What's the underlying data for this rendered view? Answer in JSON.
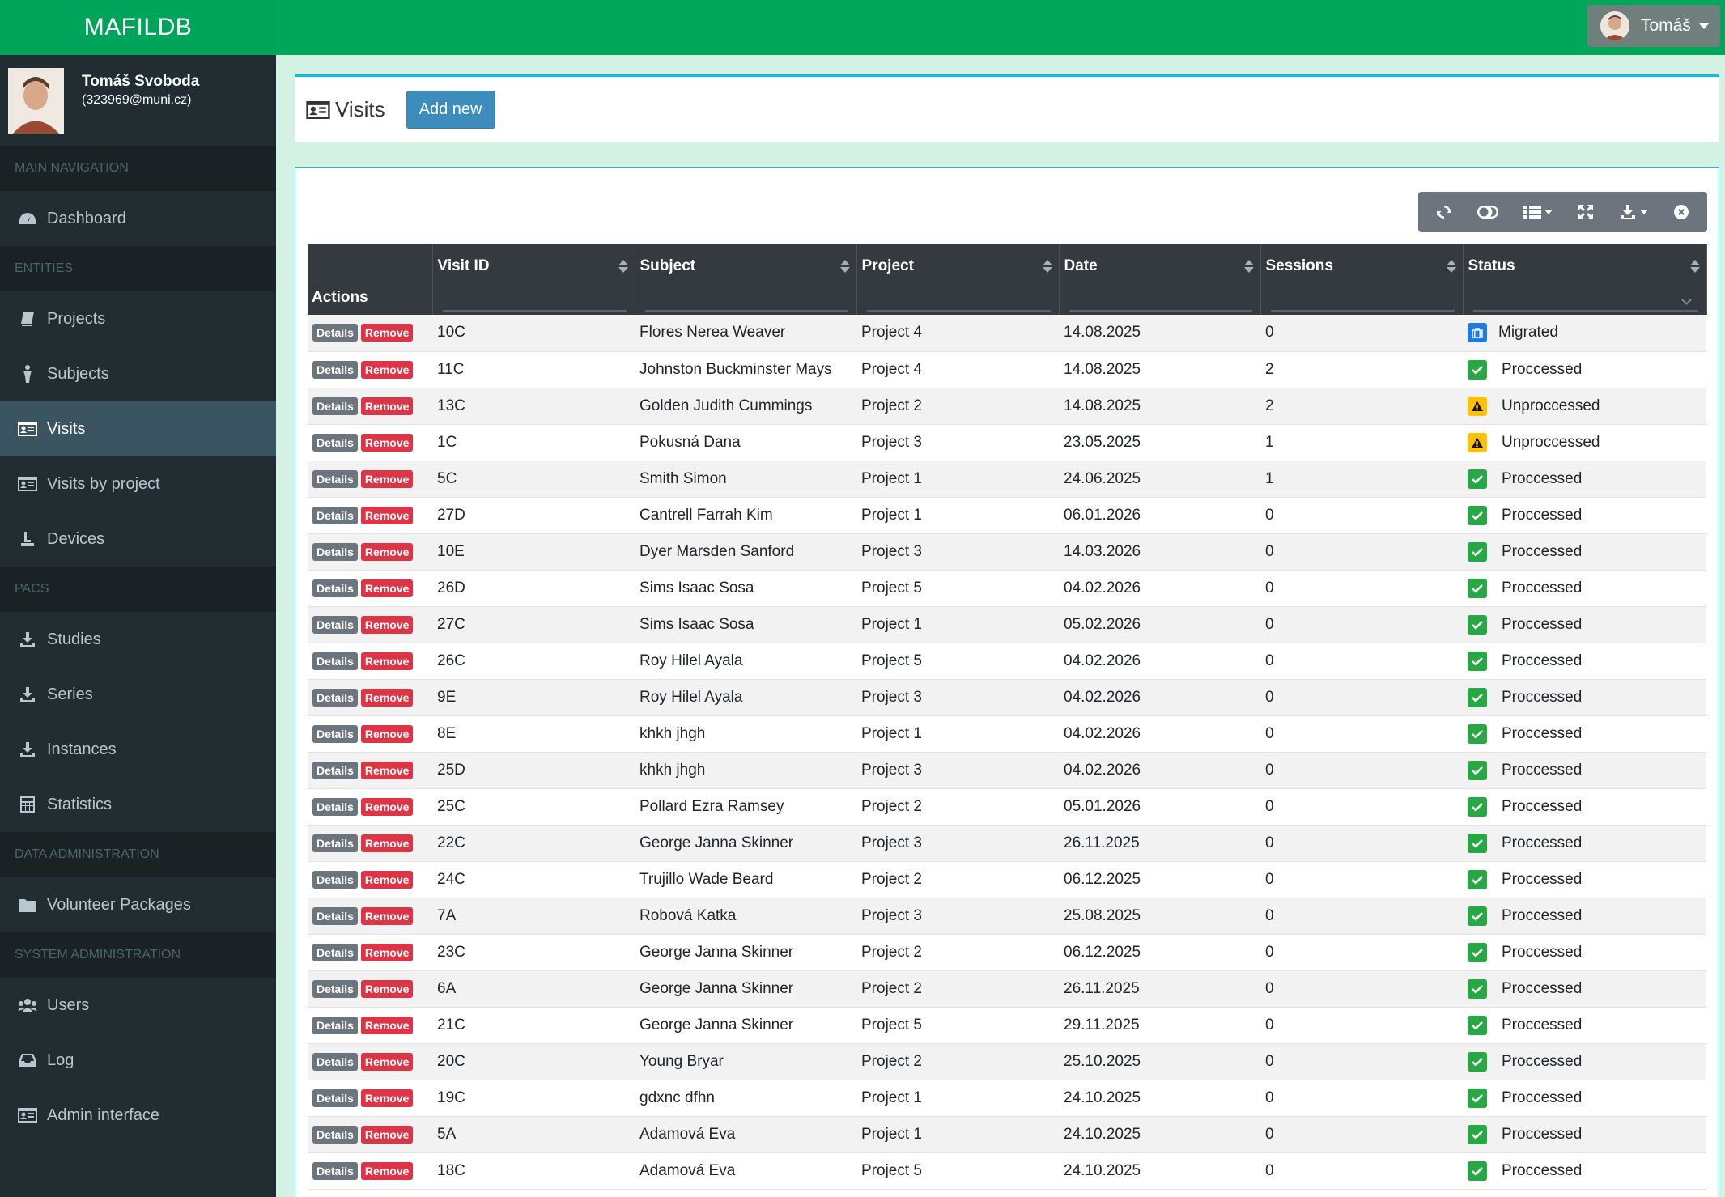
{
  "app": {
    "brand": "MAFILDB"
  },
  "topbar": {
    "user_label": "Tomáš"
  },
  "sidebar": {
    "user": {
      "name": "Tomáš Svoboda",
      "email": "(323969@muni.cz)"
    },
    "sections": {
      "main": "MAIN NAVIGATION",
      "entities": "ENTITIES",
      "pacs": "PACS",
      "data_admin": "DATA ADMINISTRATION",
      "system_admin": "SYSTEM ADMINISTRATION"
    },
    "items": {
      "dashboard": "Dashboard",
      "projects": "Projects",
      "subjects": "Subjects",
      "visits": "Visits",
      "visits_by_project": "Visits by project",
      "devices": "Devices",
      "studies": "Studies",
      "series": "Series",
      "instances": "Instances",
      "statistics": "Statistics",
      "volunteer_packages": "Volunteer Packages",
      "users": "Users",
      "log": "Log",
      "admin_interface": "Admin interface"
    }
  },
  "page": {
    "title": "Visits",
    "add_label": "Add new"
  },
  "table": {
    "columns": {
      "actions": "Actions",
      "visit_id": "Visit ID",
      "subject": "Subject",
      "project": "Project",
      "date": "Date",
      "sessions": "Sessions",
      "status": "Status"
    },
    "labels": {
      "details": "Details",
      "remove": "Remove"
    },
    "rows": [
      {
        "id": "10C",
        "subject": "Flores Nerea Weaver",
        "project": "Project 4",
        "date": "14.08.2025",
        "sessions": "0",
        "status": "Migrated",
        "kind": "mig"
      },
      {
        "id": "11C",
        "subject": "Johnston Buckminster Mays",
        "project": "Project 4",
        "date": "14.08.2025",
        "sessions": "2",
        "status": "Proccessed",
        "kind": "proc"
      },
      {
        "id": "13C",
        "subject": "Golden Judith Cummings",
        "project": "Project 2",
        "date": "14.08.2025",
        "sessions": "2",
        "status": "Unproccessed",
        "kind": "unproc"
      },
      {
        "id": "1C",
        "subject": "Pokusná Dana",
        "project": "Project 3",
        "date": "23.05.2025",
        "sessions": "1",
        "status": "Unproccessed",
        "kind": "unproc"
      },
      {
        "id": "5C",
        "subject": "Smith Simon",
        "project": "Project 1",
        "date": "24.06.2025",
        "sessions": "1",
        "status": "Proccessed",
        "kind": "proc"
      },
      {
        "id": "27D",
        "subject": "Cantrell Farrah Kim",
        "project": "Project 1",
        "date": "06.01.2026",
        "sessions": "0",
        "status": "Proccessed",
        "kind": "proc"
      },
      {
        "id": "10E",
        "subject": "Dyer Marsden Sanford",
        "project": "Project 3",
        "date": "14.03.2026",
        "sessions": "0",
        "status": "Proccessed",
        "kind": "proc"
      },
      {
        "id": "26D",
        "subject": "Sims Isaac Sosa",
        "project": "Project 5",
        "date": "04.02.2026",
        "sessions": "0",
        "status": "Proccessed",
        "kind": "proc"
      },
      {
        "id": "27C",
        "subject": "Sims Isaac Sosa",
        "project": "Project 1",
        "date": "05.02.2026",
        "sessions": "0",
        "status": "Proccessed",
        "kind": "proc"
      },
      {
        "id": "26C",
        "subject": "Roy Hilel Ayala",
        "project": "Project 5",
        "date": "04.02.2026",
        "sessions": "0",
        "status": "Proccessed",
        "kind": "proc"
      },
      {
        "id": "9E",
        "subject": "Roy Hilel Ayala",
        "project": "Project 3",
        "date": "04.02.2026",
        "sessions": "0",
        "status": "Proccessed",
        "kind": "proc"
      },
      {
        "id": "8E",
        "subject": "khkh jhgh",
        "project": "Project 1",
        "date": "04.02.2026",
        "sessions": "0",
        "status": "Proccessed",
        "kind": "proc"
      },
      {
        "id": "25D",
        "subject": "khkh jhgh",
        "project": "Project 3",
        "date": "04.02.2026",
        "sessions": "0",
        "status": "Proccessed",
        "kind": "proc"
      },
      {
        "id": "25C",
        "subject": "Pollard Ezra Ramsey",
        "project": "Project 2",
        "date": "05.01.2026",
        "sessions": "0",
        "status": "Proccessed",
        "kind": "proc"
      },
      {
        "id": "22C",
        "subject": "George Janna Skinner",
        "project": "Project 3",
        "date": "26.11.2025",
        "sessions": "0",
        "status": "Proccessed",
        "kind": "proc"
      },
      {
        "id": "24C",
        "subject": "Trujillo Wade Beard",
        "project": "Project 2",
        "date": "06.12.2025",
        "sessions": "0",
        "status": "Proccessed",
        "kind": "proc"
      },
      {
        "id": "7A",
        "subject": "Robová Katka",
        "project": "Project 3",
        "date": "25.08.2025",
        "sessions": "0",
        "status": "Proccessed",
        "kind": "proc"
      },
      {
        "id": "23C",
        "subject": "George Janna Skinner",
        "project": "Project 2",
        "date": "06.12.2025",
        "sessions": "0",
        "status": "Proccessed",
        "kind": "proc"
      },
      {
        "id": "6A",
        "subject": "George Janna Skinner",
        "project": "Project 2",
        "date": "26.11.2025",
        "sessions": "0",
        "status": "Proccessed",
        "kind": "proc"
      },
      {
        "id": "21C",
        "subject": "George Janna Skinner",
        "project": "Project 5",
        "date": "29.11.2025",
        "sessions": "0",
        "status": "Proccessed",
        "kind": "proc"
      },
      {
        "id": "20C",
        "subject": "Young Bryar",
        "project": "Project 2",
        "date": "25.10.2025",
        "sessions": "0",
        "status": "Proccessed",
        "kind": "proc"
      },
      {
        "id": "19C",
        "subject": "gdxnc dfhn",
        "project": "Project 1",
        "date": "24.10.2025",
        "sessions": "0",
        "status": "Proccessed",
        "kind": "proc"
      },
      {
        "id": "5A",
        "subject": "Adamová Eva",
        "project": "Project 1",
        "date": "24.10.2025",
        "sessions": "0",
        "status": "Proccessed",
        "kind": "proc"
      },
      {
        "id": "18C",
        "subject": "Adamová Eva",
        "project": "Project 5",
        "date": "24.10.2025",
        "sessions": "0",
        "status": "Proccessed",
        "kind": "proc"
      }
    ]
  },
  "colors": {
    "brand": "#00a65a",
    "sidebar": "#222d32",
    "primary": "#3c8dbc",
    "danger": "#dc3545",
    "success": "#28a745",
    "warning": "#ffc107",
    "info": "#1e7be6"
  }
}
